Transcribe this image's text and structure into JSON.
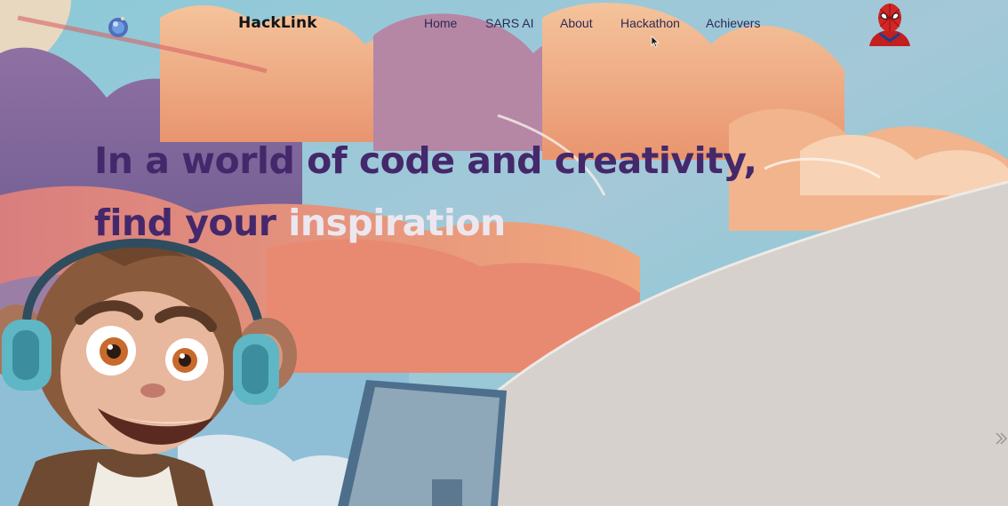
{
  "brand": {
    "name": "HackLink",
    "logo_icon": "orb-logo-icon"
  },
  "nav": {
    "items": [
      {
        "label": "Home"
      },
      {
        "label": "SARS AI"
      },
      {
        "label": "About"
      },
      {
        "label": "Hackathon"
      },
      {
        "label": "Achievers"
      }
    ]
  },
  "profile": {
    "avatar_icon": "spiderman-avatar-icon"
  },
  "hero": {
    "line1": "In a world of code and creativity,",
    "line2_prefix": "find your ",
    "line2_accent": "inspiration"
  },
  "colors": {
    "headline": "#44286b",
    "headline_accent": "#ece7ef",
    "nav_text": "#2c2a55",
    "brand_text": "#141414",
    "sky": "#7fc9d4",
    "cloud_peach": "#f2b890",
    "cloud_purple": "#7f6699",
    "monitor_wall": "#d6d1cc"
  }
}
